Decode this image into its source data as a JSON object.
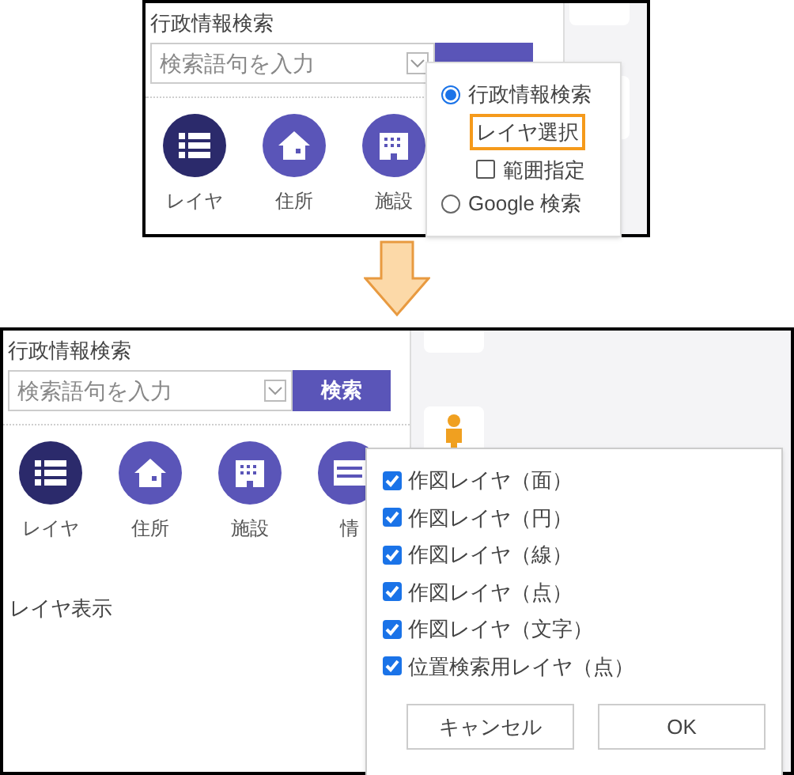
{
  "before": {
    "search_label": "行政情報検索",
    "search_field": {
      "placeholder": "検索語句を入力"
    },
    "categories": [
      {
        "label": "レイヤ",
        "kind": "list",
        "selected": true
      },
      {
        "label": "住所",
        "kind": "house",
        "selected": false
      },
      {
        "label": "施設",
        "kind": "building",
        "selected": false
      }
    ],
    "search_mode_menu": [
      {
        "kind": "radio",
        "label": "行政情報検索",
        "selected": true
      },
      {
        "kind": "link",
        "label": "レイヤ選択",
        "highlighted": true
      },
      {
        "kind": "checkbox",
        "label": "範囲指定",
        "checked": false
      },
      {
        "kind": "radio",
        "label": "Google 検索",
        "selected": false
      }
    ]
  },
  "after": {
    "search_label": "行政情報検索",
    "search_field": {
      "placeholder": "検索語句を入力"
    },
    "search_button": "検索",
    "categories": [
      {
        "label": "レイヤ",
        "kind": "list",
        "selected": true
      },
      {
        "label": "住所",
        "kind": "house",
        "selected": false
      },
      {
        "label": "施設",
        "kind": "building",
        "selected": false
      },
      {
        "label": "情",
        "kind": "info",
        "selected": false
      }
    ],
    "section_title": "レイヤ表示",
    "layer_dialog": {
      "layers": [
        {
          "label": "作図レイヤ（面）",
          "checked": true
        },
        {
          "label": "作図レイヤ（円）",
          "checked": true
        },
        {
          "label": "作図レイヤ（線）",
          "checked": true
        },
        {
          "label": "作図レイヤ（点）",
          "checked": true
        },
        {
          "label": "作図レイヤ（文字）",
          "checked": true
        },
        {
          "label": "位置検索用レイヤ（点）",
          "checked": true
        }
      ],
      "buttons": [
        "キャンセル",
        "OK"
      ]
    }
  }
}
